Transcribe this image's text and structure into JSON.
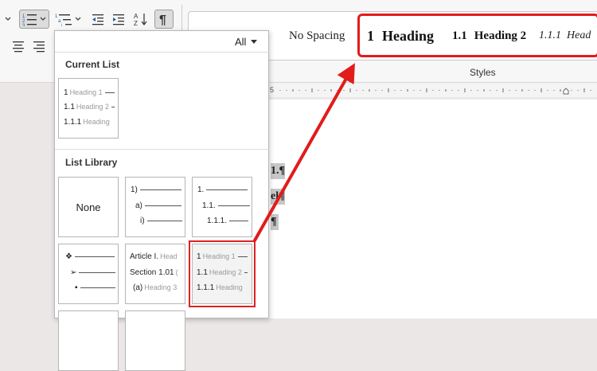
{
  "ribbon": {
    "sort_label": "A Z",
    "styles": {
      "no_spacing": "No Spacing",
      "h1_num": "1",
      "h1_text": "Heading",
      "h2_num": "1.1",
      "h2_text": "Heading 2",
      "h3_num": "1.1.1",
      "h3_text": "Head",
      "group_label": "Styles"
    }
  },
  "document": {
    "line1": "1.¶",
    "line2": "el¶",
    "line3": "¶"
  },
  "panel": {
    "filter": "All",
    "current_list_title": "Current List",
    "list_library_title": "List Library",
    "current_list": [
      {
        "num": "1",
        "label": "Heading 1"
      },
      {
        "num": "1.1",
        "label": "Heading 2"
      },
      {
        "num": "1.1.1",
        "label": "Heading"
      }
    ],
    "none_label": "None",
    "tile_paren": [
      "1)",
      "a)",
      "i)"
    ],
    "tile_decimal": [
      "1.",
      "1.1.",
      "1.1.1."
    ],
    "tile_bullets": [
      "❖",
      "➢",
      "▪"
    ],
    "tile_article": [
      {
        "num": "Article I.",
        "label": "Head"
      },
      {
        "num": "Section 1.01",
        "label": "("
      },
      {
        "num": "(a)",
        "label": "Heading 3"
      }
    ],
    "tile_heading": [
      {
        "num": "1",
        "label": "Heading 1"
      },
      {
        "num": "1.1",
        "label": "Heading 2"
      },
      {
        "num": "1.1.1",
        "label": "Heading"
      }
    ]
  },
  "colors": {
    "annotation": "#e21b1b"
  }
}
